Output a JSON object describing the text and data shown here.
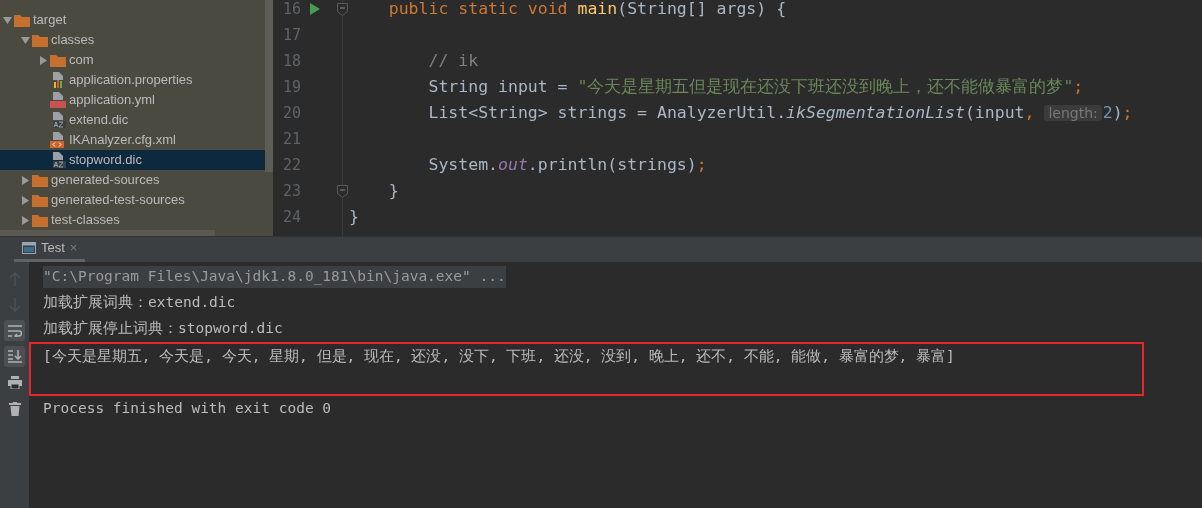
{
  "project_tree": {
    "items": [
      {
        "label": "target",
        "kind": "folder",
        "expanded": true,
        "selected": false,
        "children": [
          {
            "label": "classes",
            "kind": "folder",
            "expanded": true,
            "selected": false,
            "children": [
              {
                "label": "com",
                "kind": "folder",
                "expanded": false,
                "selected": false
              },
              {
                "label": "application.properties",
                "kind": "properties",
                "selected": false
              },
              {
                "label": "application.yml",
                "kind": "yml",
                "selected": false
              },
              {
                "label": "extend.dic",
                "kind": "dic",
                "selected": false
              },
              {
                "label": "IKAnalyzer.cfg.xml",
                "kind": "xml",
                "selected": false
              },
              {
                "label": "stopword.dic",
                "kind": "dic",
                "selected": true
              }
            ]
          },
          {
            "label": "generated-sources",
            "kind": "folder",
            "expanded": false,
            "selected": false
          },
          {
            "label": "generated-test-sources",
            "kind": "folder",
            "expanded": false,
            "selected": false
          },
          {
            "label": "test-classes",
            "kind": "folder",
            "expanded": false,
            "selected": false
          }
        ]
      }
    ]
  },
  "editor": {
    "lines": [
      {
        "number": "16",
        "run": true,
        "fold": true,
        "tokens": [
          {
            "kind": "keyword",
            "text": "    public static void "
          },
          {
            "kind": "method",
            "text": "main"
          },
          {
            "kind": "plain",
            "text": "(String[] args) {"
          }
        ]
      },
      {
        "number": "17",
        "run": false,
        "fold": false
      },
      {
        "number": "18",
        "run": false,
        "fold": false,
        "tokens": [
          {
            "kind": "comment",
            "text": "        // ik"
          }
        ]
      },
      {
        "number": "19",
        "run": false,
        "fold": false,
        "tokens": [
          {
            "kind": "plain",
            "text": "        String input = "
          },
          {
            "kind": "string",
            "text": "\"今天是星期五但是现在还没下班还没到晚上，还不能做暴富的梦\""
          },
          {
            "kind": "punct",
            "text": ";"
          }
        ]
      },
      {
        "number": "20",
        "run": false,
        "fold": false,
        "tokens": [
          {
            "kind": "plain",
            "text": "        List<String> strings = AnalyzerUtil."
          },
          {
            "kind": "static-method",
            "text": "ikSegmentationList"
          },
          {
            "kind": "plain",
            "text": "(input"
          },
          {
            "kind": "punct",
            "text": ", "
          },
          {
            "kind": "hint",
            "text": "length:"
          },
          {
            "kind": "number",
            "text": "2"
          },
          {
            "kind": "plain",
            "text": ")"
          },
          {
            "kind": "punct",
            "text": ";"
          }
        ]
      },
      {
        "number": "21",
        "run": false,
        "fold": false
      },
      {
        "number": "22",
        "run": false,
        "fold": false,
        "tokens": [
          {
            "kind": "plain",
            "text": "        System."
          },
          {
            "kind": "static-field",
            "text": "out"
          },
          {
            "kind": "plain",
            "text": ".println(strings)"
          },
          {
            "kind": "punct",
            "text": ";"
          }
        ]
      },
      {
        "number": "23",
        "run": false,
        "fold": true,
        "tokens": [
          {
            "kind": "plain",
            "text": "    }"
          }
        ]
      },
      {
        "number": "24",
        "run": false,
        "fold": false,
        "tokens": [
          {
            "kind": "plain",
            "text": "}"
          }
        ]
      }
    ]
  },
  "run_panel": {
    "tabs": [
      {
        "label": "Test",
        "selected": true,
        "close": "×"
      }
    ],
    "toolbar": [
      {
        "kind": "up",
        "on": false,
        "disabled": true
      },
      {
        "kind": "down",
        "on": false,
        "disabled": true
      },
      {
        "kind": "wrap",
        "on": true,
        "disabled": false
      },
      {
        "kind": "scroll-end",
        "on": true,
        "disabled": false
      },
      {
        "kind": "print",
        "on": false,
        "disabled": false
      },
      {
        "kind": "trash",
        "on": false,
        "disabled": false
      }
    ],
    "console": [
      {
        "kind": "command",
        "text": "\"C:\\Program Files\\Java\\jdk1.8.0_181\\bin\\java.exe\" ...",
        "highlighted": false
      },
      {
        "kind": "output",
        "text": "加载扩展词典：extend.dic",
        "highlighted": false
      },
      {
        "kind": "output",
        "text": "加载扩展停止词典：stopword.dic",
        "highlighted": false
      },
      {
        "kind": "output",
        "text": "[今天是星期五, 今天是, 今天, 星期, 但是, 现在, 还没, 没下, 下班, 还没, 没到, 晚上, 还不, 不能, 能做, 暴富的梦, 暴富]",
        "highlighted": true
      },
      {
        "kind": "exit",
        "text": "Process finished with exit code 0",
        "highlighted": false
      }
    ]
  }
}
